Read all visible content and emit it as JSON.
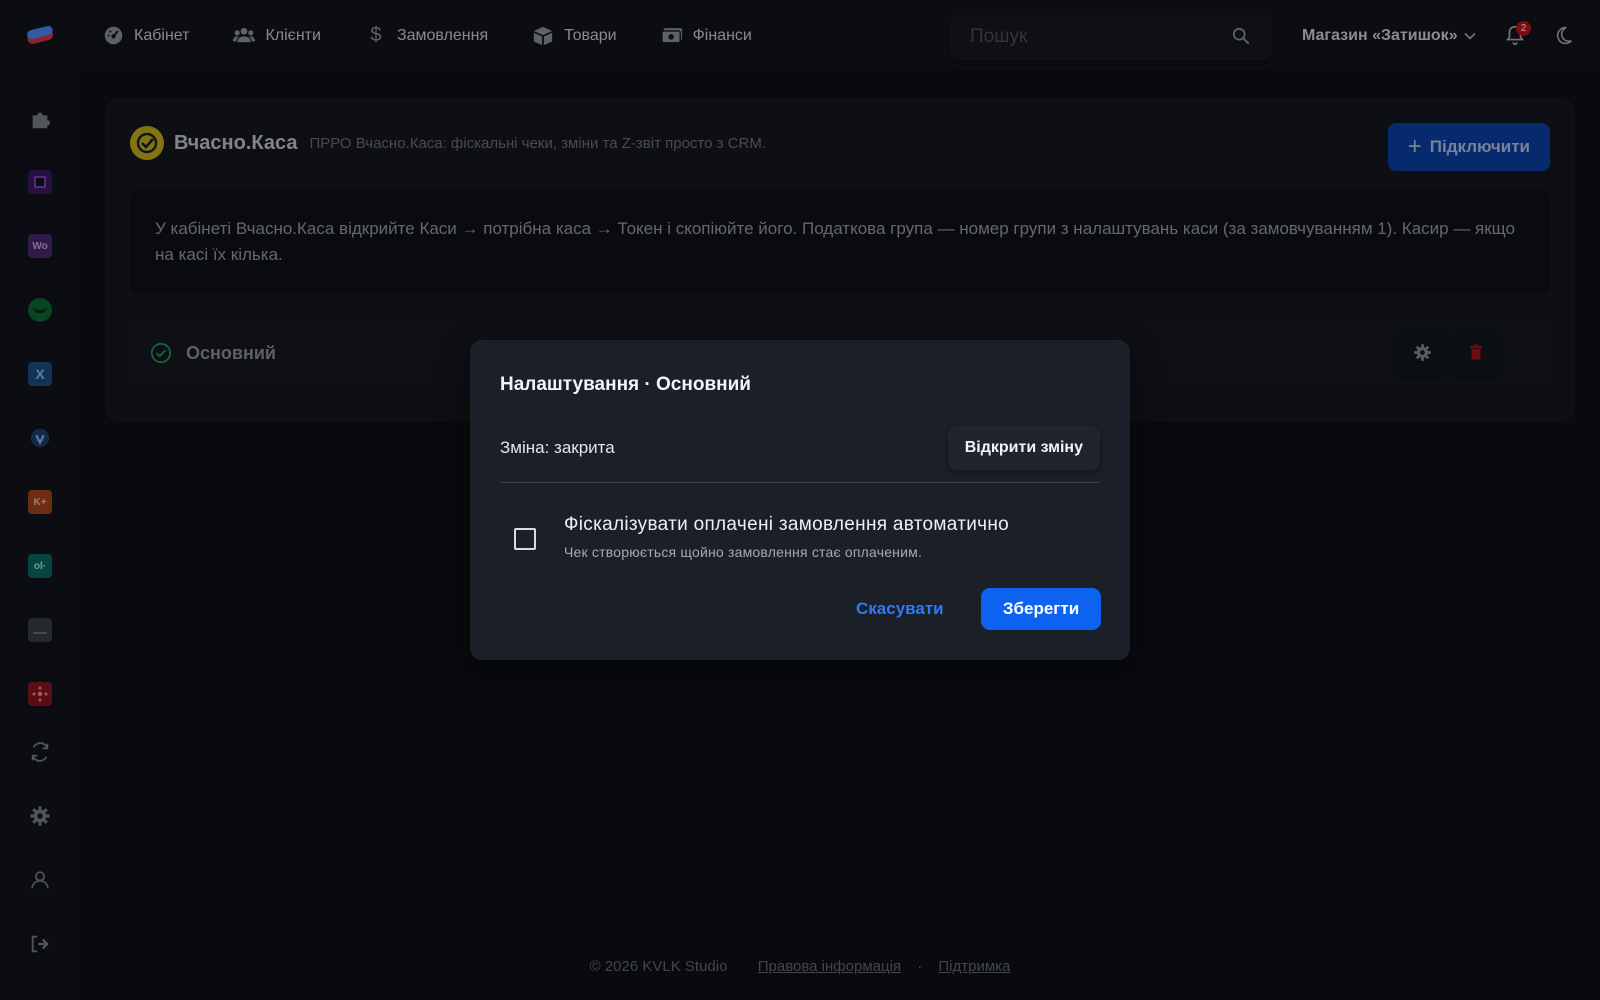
{
  "nav": {
    "items": [
      {
        "label": "Кабінет",
        "icon": "dashboard-icon"
      },
      {
        "label": "Клієнти",
        "icon": "users-icon"
      },
      {
        "label": "Замовлення",
        "icon": "dollar-icon"
      },
      {
        "label": "Товари",
        "icon": "box-icon"
      },
      {
        "label": "Фінанси",
        "icon": "money-icon"
      }
    ]
  },
  "search": {
    "placeholder": "Пошук"
  },
  "store": {
    "name": "Магазин «Затишок»"
  },
  "notifications": {
    "count": "2"
  },
  "sidebar": {
    "items": [
      {
        "icon": "puzzle-icon",
        "color": "#2a2f38"
      },
      {
        "icon": "square-app-icon",
        "color": "#3b1a63"
      },
      {
        "icon": "woo-icon",
        "label": "Wo",
        "color": "#4b2a6e"
      },
      {
        "icon": "green-app-icon",
        "color": "#0d6a35"
      },
      {
        "icon": "x-app-icon",
        "label": "X",
        "color": "#1b4f86"
      },
      {
        "icon": "shield-app-icon",
        "color": "#1d4072"
      },
      {
        "icon": "k-app-icon",
        "label": "K+",
        "color": "#a8461a"
      },
      {
        "icon": "ol-app-icon",
        "label": "ol·",
        "color": "#0f6b63"
      },
      {
        "icon": "image-app-icon",
        "color": "#3a3f47"
      },
      {
        "icon": "network-app-icon",
        "color": "#8a1520"
      },
      {
        "icon": "sync-icon"
      },
      {
        "icon": "gear-icon"
      },
      {
        "icon": "user-icon"
      },
      {
        "icon": "logout-icon"
      }
    ]
  },
  "integration": {
    "name": "Вчасно.Каса",
    "description": "ПРРО Вчасно.Каса: фіскальні чеки, зміни та Z-звіт просто з CRM.",
    "connect_label": "Підключити",
    "info_text": "У кабінеті Вчасно.Каса відкрийте Каси → потрібна каса → Токен і скопіюйте його. Податкова група — номер групи з налаштувань каси (за замовчуванням 1). Касир — якщо на касі їх кілька."
  },
  "kasa": {
    "name": "Основний"
  },
  "modal": {
    "title": "Налаштування · Основний",
    "shift_status": "Зміна: закрита",
    "open_shift_label": "Відкрити зміну",
    "auto_fiscal_label": "Фіскалізувати оплачені замовлення автоматично",
    "auto_fiscal_hint": "Чек створюється щойно замовлення стає оплаченим.",
    "auto_fiscal_checked": false,
    "cancel_label": "Скасувати",
    "save_label": "Зберегти"
  },
  "footer": {
    "copyright": "© 2026 KVLK Studio",
    "legal_link": "Правова інформація",
    "separator": "·",
    "support_link": "Підтримка"
  },
  "colors": {
    "accent": "#0d63f0",
    "brand_yellow": "#c8b21a",
    "success": "#1f9a55",
    "danger": "#c0141c"
  }
}
